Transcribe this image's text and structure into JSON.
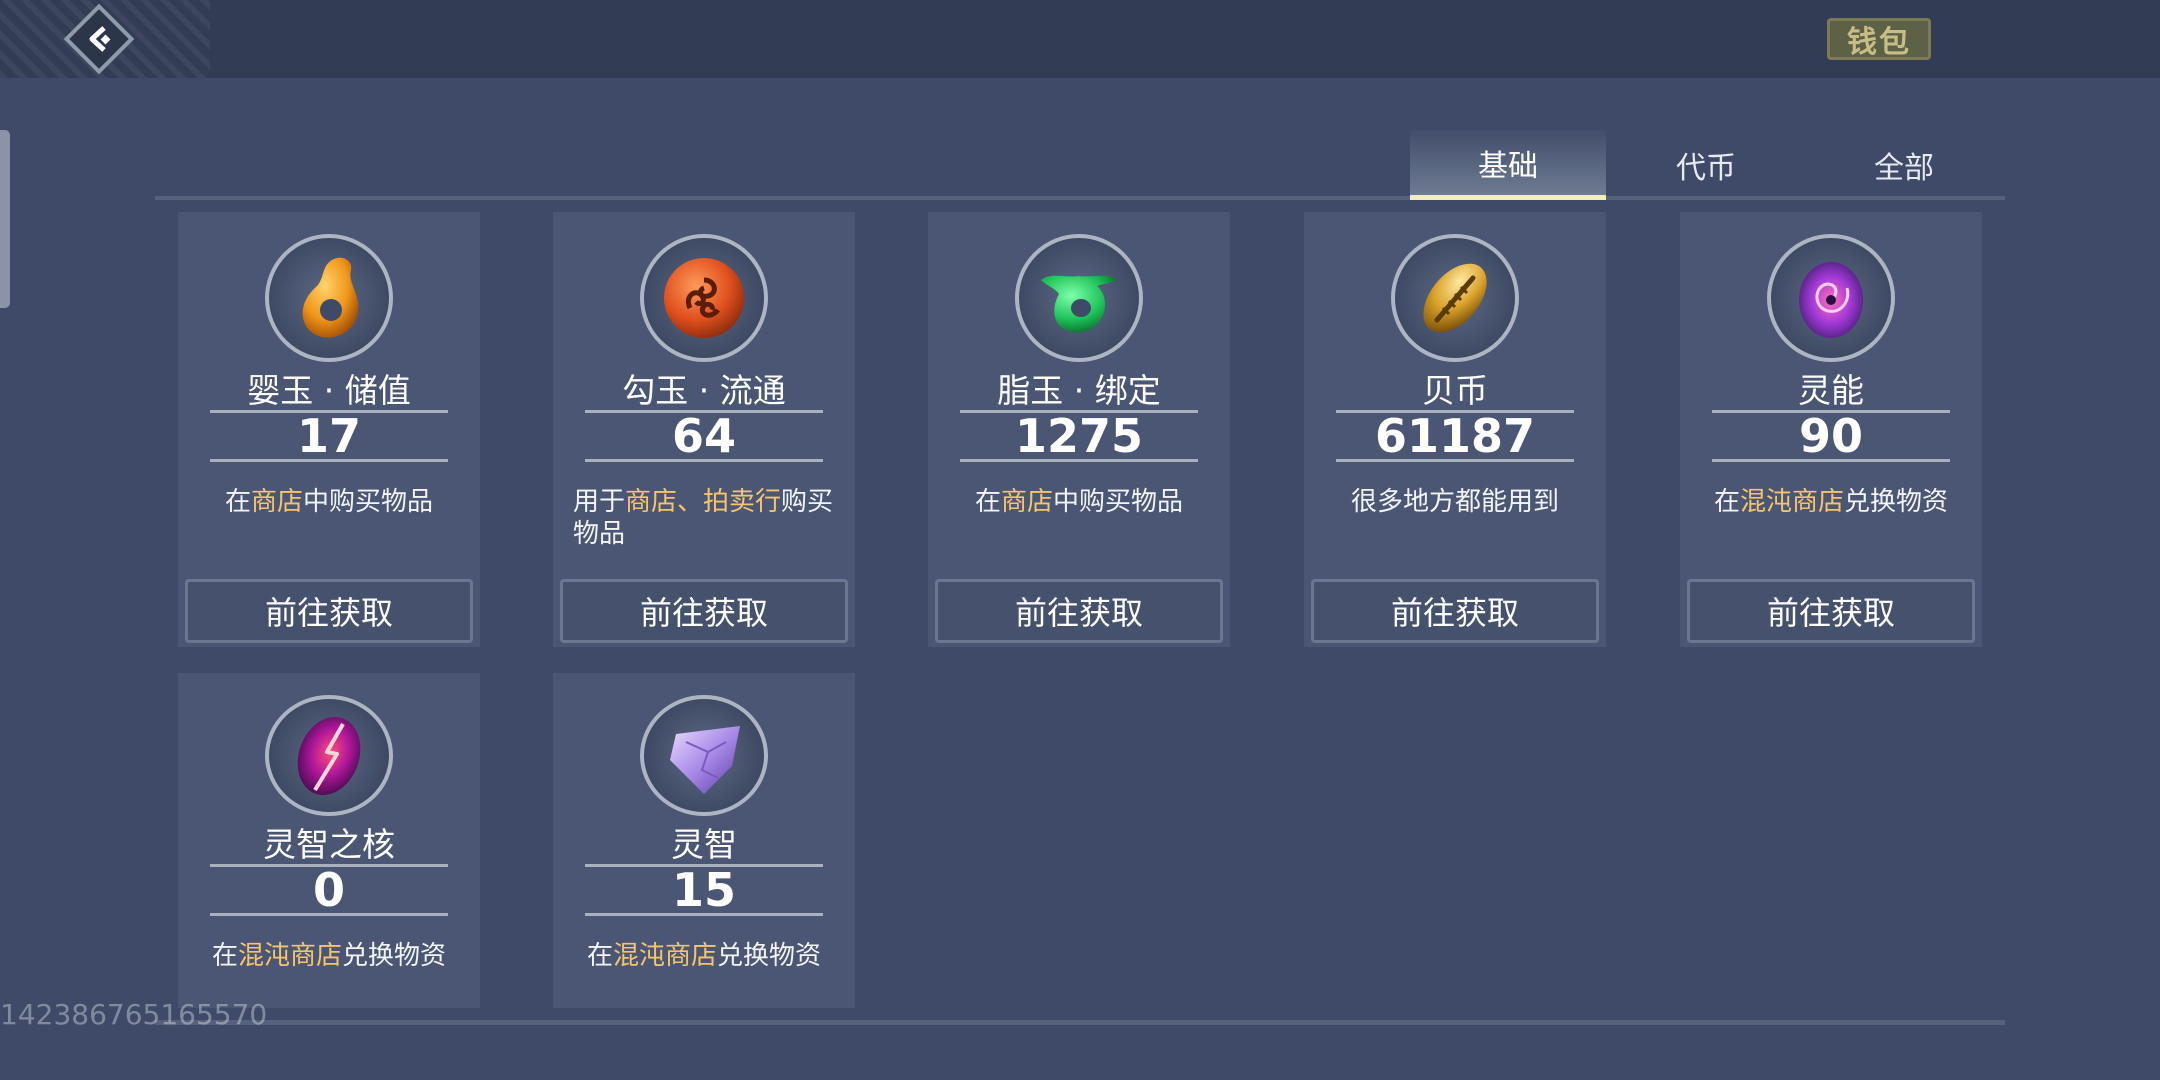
{
  "header": {
    "wallet_label": "钱包"
  },
  "tabs": [
    {
      "label": "基础",
      "active": true
    },
    {
      "label": "代币",
      "active": false
    },
    {
      "label": "全部",
      "active": false
    }
  ],
  "cards": [
    {
      "name": "婴玉 · 储值",
      "value": "17",
      "desc_pre": "在",
      "desc_hl": "商店",
      "desc_post": "中购买物品",
      "button": "前往获取",
      "icon": "orange-jade-icon"
    },
    {
      "name": "勾玉 · 流通",
      "value": "64",
      "desc_pre": "用于",
      "desc_hl": "商店、拍卖行",
      "desc_post": "购买物品",
      "button": "前往获取",
      "icon": "red-swirl-jade-icon"
    },
    {
      "name": "脂玉 · 绑定",
      "value": "1275",
      "desc_pre": "在",
      "desc_hl": "商店",
      "desc_post": "中购买物品",
      "button": "前往获取",
      "icon": "green-jade-icon"
    },
    {
      "name": "贝币",
      "value": "61187",
      "desc_pre": "很多地方都能用到",
      "desc_hl": "",
      "desc_post": "",
      "button": "前往获取",
      "icon": "gold-shell-icon"
    },
    {
      "name": "灵能",
      "value": "90",
      "desc_pre": "在",
      "desc_hl": "混沌商店",
      "desc_post": "兑换物资",
      "button": "前往获取",
      "icon": "purple-vortex-icon"
    },
    {
      "name": "灵智之核",
      "value": "0",
      "desc_pre": "在",
      "desc_hl": "混沌商店",
      "desc_post": "兑换物资",
      "button": "",
      "icon": "magenta-core-icon"
    },
    {
      "name": "灵智",
      "value": "15",
      "desc_pre": "在",
      "desc_hl": "混沌商店",
      "desc_post": "兑换物资",
      "button": "",
      "icon": "violet-crystal-icon"
    }
  ],
  "uid": "142386765165570"
}
